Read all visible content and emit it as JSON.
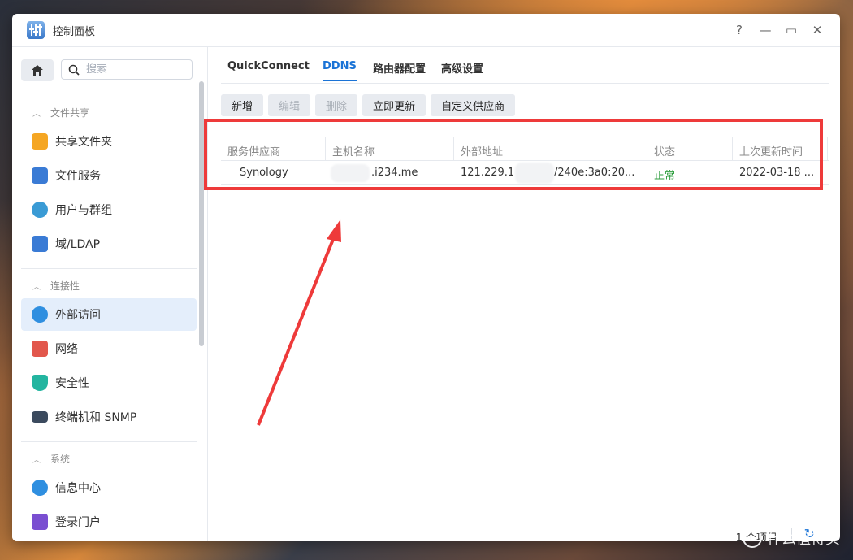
{
  "window": {
    "title": "控制面板",
    "controls": [
      "?",
      "—",
      "▭",
      "✕"
    ]
  },
  "sidebar": {
    "search_placeholder": "搜索",
    "sections": [
      {
        "label": "文件共享",
        "items": [
          {
            "label": "共享文件夹",
            "icon": "folder-icon",
            "color": "#f5a623"
          },
          {
            "label": "文件服务",
            "icon": "file-service-icon",
            "color": "#3a7bd5"
          },
          {
            "label": "用户与群组",
            "icon": "users-icon",
            "color": "#3a9bd5"
          },
          {
            "label": "域/LDAP",
            "icon": "ldap-icon",
            "color": "#3a7bd5"
          }
        ]
      },
      {
        "label": "连接性",
        "items": [
          {
            "label": "外部访问",
            "icon": "globe-icon",
            "color": "#2f8fe0",
            "active": true
          },
          {
            "label": "网络",
            "icon": "home-network-icon",
            "color": "#e2574c"
          },
          {
            "label": "安全性",
            "icon": "shield-icon",
            "color": "#23b5a0"
          },
          {
            "label": "终端机和 SNMP",
            "icon": "terminal-icon",
            "color": "#3b4a5e"
          }
        ]
      },
      {
        "label": "系统",
        "items": [
          {
            "label": "信息中心",
            "icon": "info-icon",
            "color": "#2f8fe0"
          },
          {
            "label": "登录门户",
            "icon": "login-portal-icon",
            "color": "#7a4fd1"
          }
        ]
      }
    ]
  },
  "tabs": [
    {
      "label": "QuickConnect",
      "active": false
    },
    {
      "label": "DDNS",
      "active": true
    },
    {
      "label": "路由器配置",
      "active": false
    },
    {
      "label": "高级设置",
      "active": false
    }
  ],
  "toolbar": [
    {
      "label": "新增",
      "enabled": true
    },
    {
      "label": "编辑",
      "enabled": false
    },
    {
      "label": "删除",
      "enabled": false
    },
    {
      "label": "立即更新",
      "enabled": true
    },
    {
      "label": "自定义供应商",
      "enabled": true
    }
  ],
  "grid": {
    "columns": [
      "服务供应商",
      "主机名称",
      "外部地址",
      "状态",
      "上次更新时间"
    ],
    "rows": [
      {
        "provider": "Synology",
        "hostname": ".i234.me",
        "address_a": "121.229.1",
        "address_b": "/240e:3a0:20...",
        "status": "正常",
        "updated": "2022-03-18 ..."
      }
    ]
  },
  "footer": {
    "count": "1 个项目"
  },
  "watermark": "什么值得买",
  "colors": {
    "accent": "#1a73d6",
    "status_ok": "#2e9e3e",
    "highlight": "#ee3a3a"
  }
}
